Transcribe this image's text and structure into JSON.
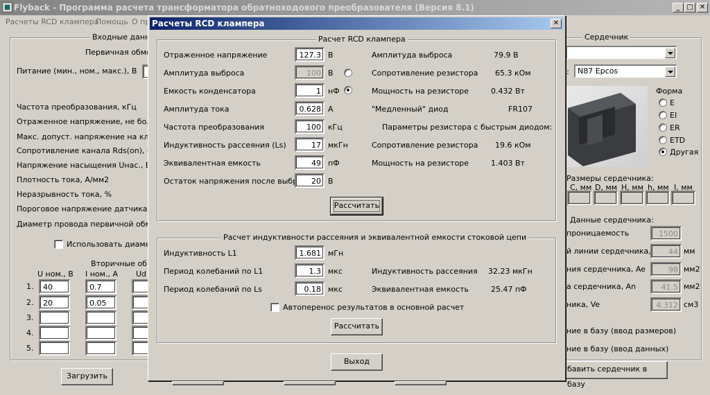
{
  "main_window": {
    "title": "Flyback - Программа расчета трансформатора обратноходового преобразователя (Версия 8.1)",
    "menu": [
      "Расчеты RCD клампера",
      "Помощь",
      "О пр"
    ],
    "input_group_title": "Входные данн",
    "primary_subtitle": "Первичная обмот",
    "supply_label": "Питание (мин., ном., макс.), В",
    "left_labels": [
      "Частота преобразования, кГц",
      "Отраженное напряжение, не более,",
      "Макс. допуст. напряжение на ключе",
      "Сопротивление канала Rds(on), Ом",
      "Напряжение насыщения Uнас., В",
      "Плотность тока, А/мм2",
      "Неразрывность тока, %",
      "Пороговое напряжение датчика тока",
      "Диаметр провода первичной обмотк"
    ],
    "use_diameter_label": "Использовать диаметр",
    "secondary_subtitle": "Вторичные обмо",
    "secondary_headers": [
      "U ном., В",
      "I ном., А",
      "Ud"
    ],
    "secondary_rows": [
      {
        "num": "1.",
        "u": "40",
        "i": "0.7"
      },
      {
        "num": "2.",
        "u": "20",
        "i": "0.05"
      },
      {
        "num": "3.",
        "u": "",
        "i": ""
      },
      {
        "num": "4.",
        "u": "",
        "i": ""
      },
      {
        "num": "5.",
        "u": "",
        "i": ""
      }
    ],
    "load_button": "Загрузить",
    "core": {
      "group_title": "Сердечник",
      "material_value": "N87 Epcos",
      "shape_title": "Форма",
      "shapes": [
        {
          "label": "E",
          "checked": false
        },
        {
          "label": "EI",
          "checked": false
        },
        {
          "label": "ER",
          "checked": false
        },
        {
          "label": "ETD",
          "checked": false
        },
        {
          "label": "Другая",
          "checked": true
        }
      ],
      "dimensions_title": "Размеры сердечника:",
      "dimension_headers": [
        "C, мм",
        "D, мм",
        "H, мм",
        "h, мм",
        "I, мм"
      ],
      "data_title": "Данные сердечника:",
      "data_rows": [
        {
          "label": "проницаемость",
          "value": "1500",
          "unit": ""
        },
        {
          "label": "й линии сердечника, le",
          "value": "44",
          "unit": "мм"
        },
        {
          "label": "ния сердечника, Ae",
          "value": "98",
          "unit": "мм2"
        },
        {
          "label": "а сердечника, An",
          "value": "41.5",
          "unit": "мм2"
        },
        {
          "label": "ника, Ve",
          "value": "4.312",
          "unit": "см3"
        }
      ],
      "base_sizes": "ние в базу (ввод размеров)",
      "base_data": "ние в базу (ввод данных)",
      "add_core_button": "бавить сердечник в базу"
    }
  },
  "dialog": {
    "title": "Расчеты RCD клампера",
    "rcd_group": {
      "title": "Расчет RCD клампера",
      "rows": [
        {
          "label": "Отраженное напряжение",
          "value": "127.3",
          "unit": "В"
        },
        {
          "label": "Амплитуда выброса",
          "value": "100",
          "unit": "В"
        },
        {
          "label": "Емкость конденсатора",
          "value": "1",
          "unit": "нФ"
        },
        {
          "label": "Амплитуда тока",
          "value": "0.628",
          "unit": "А"
        },
        {
          "label": "Частота преобразования",
          "value": "100",
          "unit": "кГц"
        },
        {
          "label": "Индуктивность рассеяния (Ls)",
          "value": "17",
          "unit": "мкГн"
        },
        {
          "label": "Эквивалентная емкость",
          "value": "49",
          "unit": "пФ"
        },
        {
          "label": "Остаток напряжения после выброса",
          "value": "20",
          "unit": "В"
        }
      ],
      "results": [
        {
          "label": "Амплитуда выброса",
          "value": "79.9 В"
        },
        {
          "label": "Сопротивление резистора",
          "value": "65.3 кОм"
        },
        {
          "label": "Мощность на резисторе",
          "value": "0.432 Вт"
        },
        {
          "label": "\"Медленный\" диод",
          "value": "FR107"
        }
      ],
      "fast_diode_title": "Параметры резистора с быстрым диодом:",
      "fast_results": [
        {
          "label": "Сопротивление резистора",
          "value": "19.6 кОм"
        },
        {
          "label": "Мощность на резисторе",
          "value": "1.403 Вт"
        }
      ],
      "calc_button": "Рассчитать"
    },
    "leak_group": {
      "title": "Расчет индуктивности рассеяния и эквивалентной емкости стоковой цепи",
      "rows": [
        {
          "label": "Индуктивность L1",
          "value": "1.681",
          "unit": "мГн"
        },
        {
          "label": "Период колебаний по L1",
          "value": "1.3",
          "unit": "мкс"
        },
        {
          "label": "Период колебаний по Ls",
          "value": "0.18",
          "unit": "мкс"
        }
      ],
      "results": [
        {
          "label": "Индуктивность рассеяния",
          "value": "32.23 мкГн"
        },
        {
          "label": "Эквивалентная емкость",
          "value": "25.47 пФ"
        }
      ],
      "auto_transfer_label": "Автоперенос результатов в основной расчет",
      "calc_button": "Рассчитать"
    },
    "exit_button": "Выход"
  }
}
